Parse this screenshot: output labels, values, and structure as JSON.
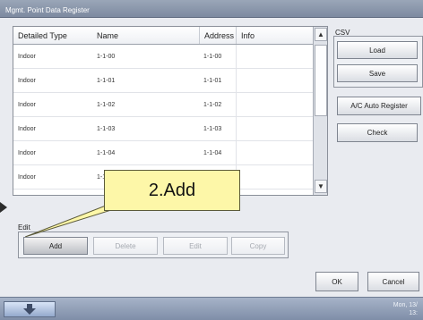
{
  "window": {
    "title": "Mgmt. Point Data Register"
  },
  "table": {
    "headers": [
      "Detailed Type",
      "Name",
      "Address",
      "Info"
    ],
    "rows": [
      [
        "Indoor",
        "1-1-00",
        "1-1-00",
        ""
      ],
      [
        "Indoor",
        "1-1-01",
        "1-1-01",
        ""
      ],
      [
        "Indoor",
        "1-1-02",
        "1-1-02",
        ""
      ],
      [
        "Indoor",
        "1-1-03",
        "1-1-03",
        ""
      ],
      [
        "Indoor",
        "1-1-04",
        "1-1-04",
        ""
      ],
      [
        "Indoor",
        "1-1-",
        "1-1-",
        ""
      ]
    ]
  },
  "csv": {
    "label": "CSV",
    "load": "Load",
    "save": "Save"
  },
  "side": {
    "auto_register": "A/C Auto Register",
    "check": "Check"
  },
  "edit": {
    "label": "Edit",
    "add": "Add",
    "delete": "Delete",
    "edit": "Edit",
    "copy": "Copy"
  },
  "dialog": {
    "ok": "OK",
    "cancel": "Cancel"
  },
  "callout": {
    "text": "2.Add"
  },
  "taskbar": {
    "clock_line1": "Mon, 13/",
    "clock_line2": "13:"
  },
  "icons": {
    "scroll_up": "▲",
    "scroll_down": "▼",
    "start": "start-arrow-icon"
  },
  "colors": {
    "callout_bg": "#fdf7a8",
    "accent": "#7d8aa0"
  }
}
